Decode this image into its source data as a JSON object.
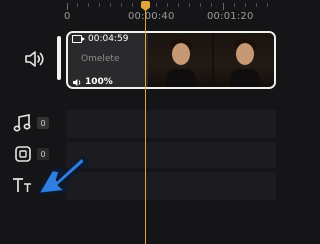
{
  "ruler": {
    "labels": [
      "0",
      "00:00:40",
      "00:01:20"
    ]
  },
  "video_track": {
    "clip_duration": "00:04:59",
    "clip_title": "Omelete",
    "clip_volume": "100%"
  },
  "audio_track": {
    "count": "0"
  },
  "sticker_track": {
    "count": "0"
  },
  "playhead": {
    "time": "00:00:40"
  },
  "colors": {
    "background": "#151518",
    "lane": "#1c1c20",
    "playhead": "#e0a23a",
    "annotation_arrow": "#2f7ddf",
    "clip_border": "#f0f0f0"
  },
  "icons": {
    "video_track": "speaker-icon",
    "audio_track": "music-note-icon",
    "sticker_track": "sticker-icon",
    "text_track": "text-tt-icon",
    "annotation": "arrow-annotation-icon"
  }
}
